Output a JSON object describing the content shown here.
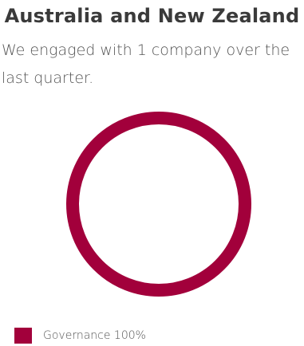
{
  "title": "Australia and New Zealand",
  "description": "We engaged with 1 company over the last quarter.",
  "colors": {
    "governance": "#a2003b"
  },
  "chart_data": {
    "type": "pie",
    "donut": true,
    "categories": [
      "Governance"
    ],
    "values": [
      100
    ],
    "unit": "%",
    "legend": [
      {
        "label": "Governance 100%",
        "color": "#a2003b"
      }
    ],
    "legend_position": "bottom-left"
  }
}
